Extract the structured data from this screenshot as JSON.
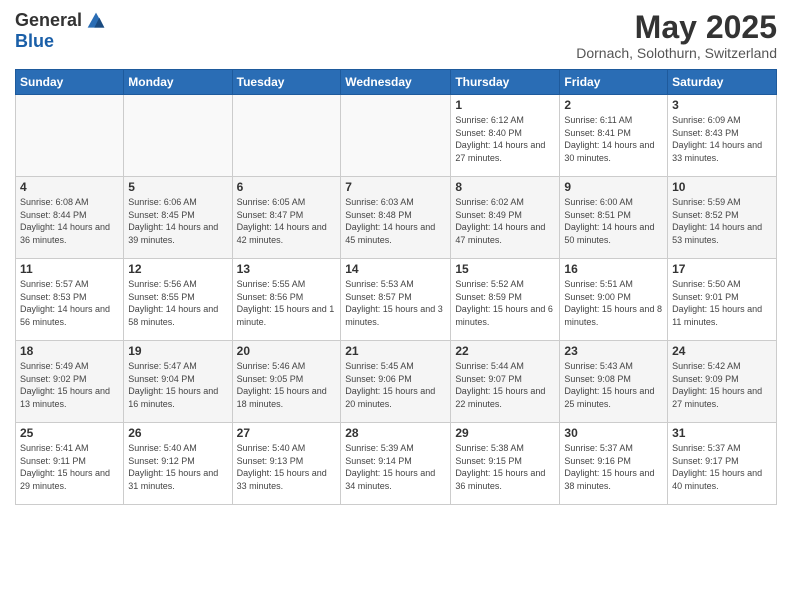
{
  "logo": {
    "general": "General",
    "blue": "Blue"
  },
  "title": "May 2025",
  "location": "Dornach, Solothurn, Switzerland",
  "weekdays": [
    "Sunday",
    "Monday",
    "Tuesday",
    "Wednesday",
    "Thursday",
    "Friday",
    "Saturday"
  ],
  "weeks": [
    [
      {
        "day": "",
        "info": ""
      },
      {
        "day": "",
        "info": ""
      },
      {
        "day": "",
        "info": ""
      },
      {
        "day": "",
        "info": ""
      },
      {
        "day": "1",
        "info": "Sunrise: 6:12 AM\nSunset: 8:40 PM\nDaylight: 14 hours and 27 minutes."
      },
      {
        "day": "2",
        "info": "Sunrise: 6:11 AM\nSunset: 8:41 PM\nDaylight: 14 hours and 30 minutes."
      },
      {
        "day": "3",
        "info": "Sunrise: 6:09 AM\nSunset: 8:43 PM\nDaylight: 14 hours and 33 minutes."
      }
    ],
    [
      {
        "day": "4",
        "info": "Sunrise: 6:08 AM\nSunset: 8:44 PM\nDaylight: 14 hours and 36 minutes."
      },
      {
        "day": "5",
        "info": "Sunrise: 6:06 AM\nSunset: 8:45 PM\nDaylight: 14 hours and 39 minutes."
      },
      {
        "day": "6",
        "info": "Sunrise: 6:05 AM\nSunset: 8:47 PM\nDaylight: 14 hours and 42 minutes."
      },
      {
        "day": "7",
        "info": "Sunrise: 6:03 AM\nSunset: 8:48 PM\nDaylight: 14 hours and 45 minutes."
      },
      {
        "day": "8",
        "info": "Sunrise: 6:02 AM\nSunset: 8:49 PM\nDaylight: 14 hours and 47 minutes."
      },
      {
        "day": "9",
        "info": "Sunrise: 6:00 AM\nSunset: 8:51 PM\nDaylight: 14 hours and 50 minutes."
      },
      {
        "day": "10",
        "info": "Sunrise: 5:59 AM\nSunset: 8:52 PM\nDaylight: 14 hours and 53 minutes."
      }
    ],
    [
      {
        "day": "11",
        "info": "Sunrise: 5:57 AM\nSunset: 8:53 PM\nDaylight: 14 hours and 56 minutes."
      },
      {
        "day": "12",
        "info": "Sunrise: 5:56 AM\nSunset: 8:55 PM\nDaylight: 14 hours and 58 minutes."
      },
      {
        "day": "13",
        "info": "Sunrise: 5:55 AM\nSunset: 8:56 PM\nDaylight: 15 hours and 1 minute."
      },
      {
        "day": "14",
        "info": "Sunrise: 5:53 AM\nSunset: 8:57 PM\nDaylight: 15 hours and 3 minutes."
      },
      {
        "day": "15",
        "info": "Sunrise: 5:52 AM\nSunset: 8:59 PM\nDaylight: 15 hours and 6 minutes."
      },
      {
        "day": "16",
        "info": "Sunrise: 5:51 AM\nSunset: 9:00 PM\nDaylight: 15 hours and 8 minutes."
      },
      {
        "day": "17",
        "info": "Sunrise: 5:50 AM\nSunset: 9:01 PM\nDaylight: 15 hours and 11 minutes."
      }
    ],
    [
      {
        "day": "18",
        "info": "Sunrise: 5:49 AM\nSunset: 9:02 PM\nDaylight: 15 hours and 13 minutes."
      },
      {
        "day": "19",
        "info": "Sunrise: 5:47 AM\nSunset: 9:04 PM\nDaylight: 15 hours and 16 minutes."
      },
      {
        "day": "20",
        "info": "Sunrise: 5:46 AM\nSunset: 9:05 PM\nDaylight: 15 hours and 18 minutes."
      },
      {
        "day": "21",
        "info": "Sunrise: 5:45 AM\nSunset: 9:06 PM\nDaylight: 15 hours and 20 minutes."
      },
      {
        "day": "22",
        "info": "Sunrise: 5:44 AM\nSunset: 9:07 PM\nDaylight: 15 hours and 22 minutes."
      },
      {
        "day": "23",
        "info": "Sunrise: 5:43 AM\nSunset: 9:08 PM\nDaylight: 15 hours and 25 minutes."
      },
      {
        "day": "24",
        "info": "Sunrise: 5:42 AM\nSunset: 9:09 PM\nDaylight: 15 hours and 27 minutes."
      }
    ],
    [
      {
        "day": "25",
        "info": "Sunrise: 5:41 AM\nSunset: 9:11 PM\nDaylight: 15 hours and 29 minutes."
      },
      {
        "day": "26",
        "info": "Sunrise: 5:40 AM\nSunset: 9:12 PM\nDaylight: 15 hours and 31 minutes."
      },
      {
        "day": "27",
        "info": "Sunrise: 5:40 AM\nSunset: 9:13 PM\nDaylight: 15 hours and 33 minutes."
      },
      {
        "day": "28",
        "info": "Sunrise: 5:39 AM\nSunset: 9:14 PM\nDaylight: 15 hours and 34 minutes."
      },
      {
        "day": "29",
        "info": "Sunrise: 5:38 AM\nSunset: 9:15 PM\nDaylight: 15 hours and 36 minutes."
      },
      {
        "day": "30",
        "info": "Sunrise: 5:37 AM\nSunset: 9:16 PM\nDaylight: 15 hours and 38 minutes."
      },
      {
        "day": "31",
        "info": "Sunrise: 5:37 AM\nSunset: 9:17 PM\nDaylight: 15 hours and 40 minutes."
      }
    ]
  ]
}
